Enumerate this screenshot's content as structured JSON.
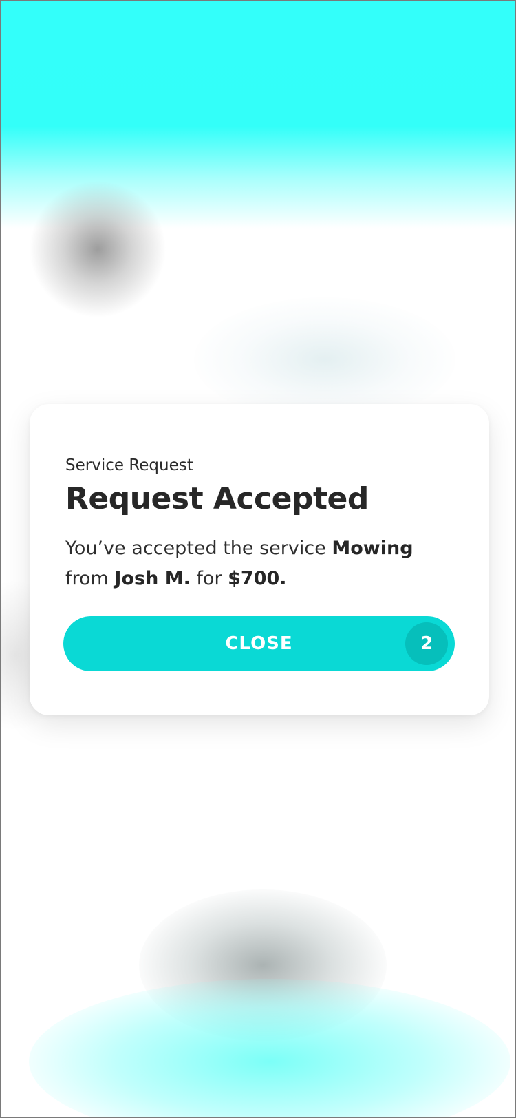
{
  "dialog": {
    "eyebrow": "Service Request",
    "title": "Request Accepted",
    "message": {
      "prefix": "You’ve accepted the service ",
      "service": "Mowing",
      "from_text": "from ",
      "customer": "Josh M.",
      "for_text": " for ",
      "price": "$700."
    },
    "close_button": {
      "label": "CLOSE",
      "countdown": "2"
    }
  },
  "colors": {
    "accent": "#0ad9d5",
    "accent_dark": "#06bfbb",
    "backdrop_cyan": "#33fffa",
    "text": "#272727",
    "card": "#ffffff"
  }
}
